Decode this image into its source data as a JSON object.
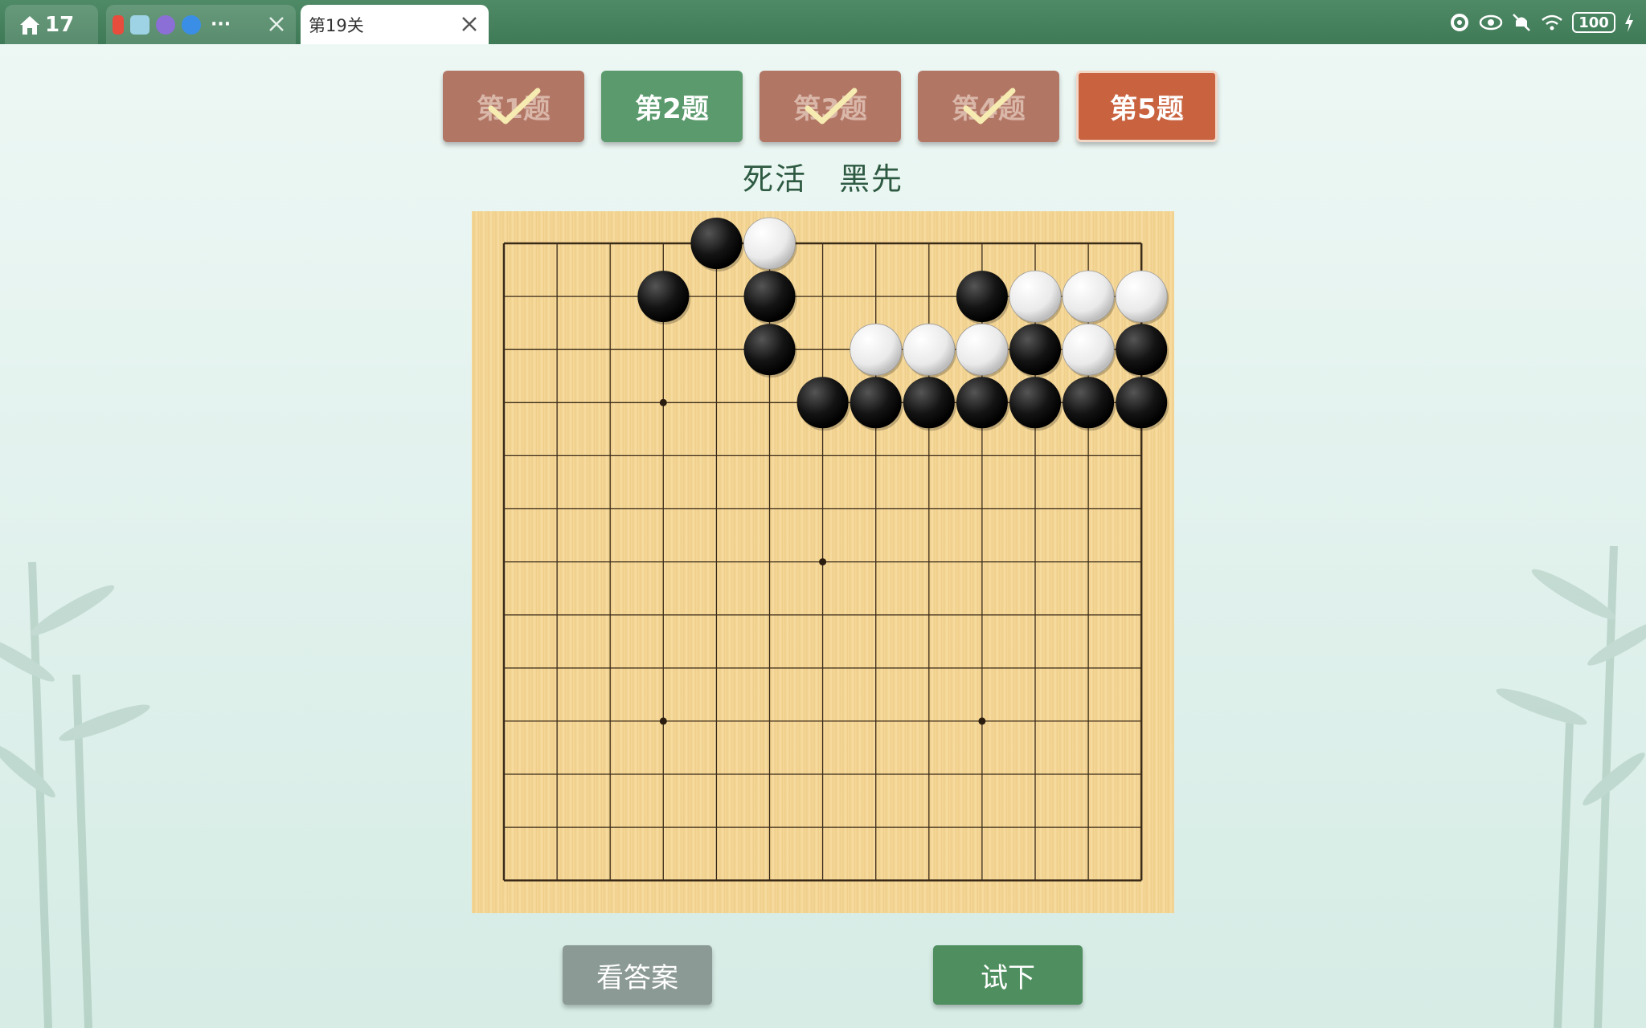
{
  "tabbar": {
    "home_tab_count": "17",
    "active_tab_title": "第19关",
    "status_battery": "100"
  },
  "problems": [
    {
      "label": "第1题",
      "state": "done"
    },
    {
      "label": "第2题",
      "state": "current"
    },
    {
      "label": "第3题",
      "state": "done"
    },
    {
      "label": "第4题",
      "state": "done"
    },
    {
      "label": "第5题",
      "state": "active"
    }
  ],
  "subtitle": "死活　黑先",
  "board": {
    "size": 13,
    "star_points": [
      [
        3,
        3
      ],
      [
        6,
        6
      ],
      [
        3,
        9
      ],
      [
        9,
        9
      ]
    ],
    "stones": [
      {
        "color": "black",
        "col": 4,
        "row": 0
      },
      {
        "color": "white",
        "col": 5,
        "row": 0
      },
      {
        "color": "black",
        "col": 3,
        "row": 1
      },
      {
        "color": "black",
        "col": 5,
        "row": 1
      },
      {
        "color": "black",
        "col": 9,
        "row": 1
      },
      {
        "color": "white",
        "col": 10,
        "row": 1
      },
      {
        "color": "white",
        "col": 11,
        "row": 1
      },
      {
        "color": "white",
        "col": 12,
        "row": 1
      },
      {
        "color": "black",
        "col": 5,
        "row": 2
      },
      {
        "color": "white",
        "col": 7,
        "row": 2
      },
      {
        "color": "white",
        "col": 8,
        "row": 2
      },
      {
        "color": "white",
        "col": 9,
        "row": 2
      },
      {
        "color": "black",
        "col": 10,
        "row": 2
      },
      {
        "color": "white",
        "col": 11,
        "row": 2
      },
      {
        "color": "black",
        "col": 12,
        "row": 2
      },
      {
        "color": "black",
        "col": 6,
        "row": 3
      },
      {
        "color": "black",
        "col": 7,
        "row": 3
      },
      {
        "color": "black",
        "col": 8,
        "row": 3
      },
      {
        "color": "black",
        "col": 9,
        "row": 3
      },
      {
        "color": "black",
        "col": 10,
        "row": 3
      },
      {
        "color": "black",
        "col": 11,
        "row": 3
      },
      {
        "color": "black",
        "col": 12,
        "row": 3
      }
    ]
  },
  "buttons": {
    "answer": "看答案",
    "try": "试下"
  },
  "colors": {
    "tabbar": "#4a8561",
    "done": "#b27665",
    "current": "#5a9a6c",
    "active": "#c9623f",
    "try_button": "#4f8f5f",
    "answer_button": "#8c9a96"
  }
}
